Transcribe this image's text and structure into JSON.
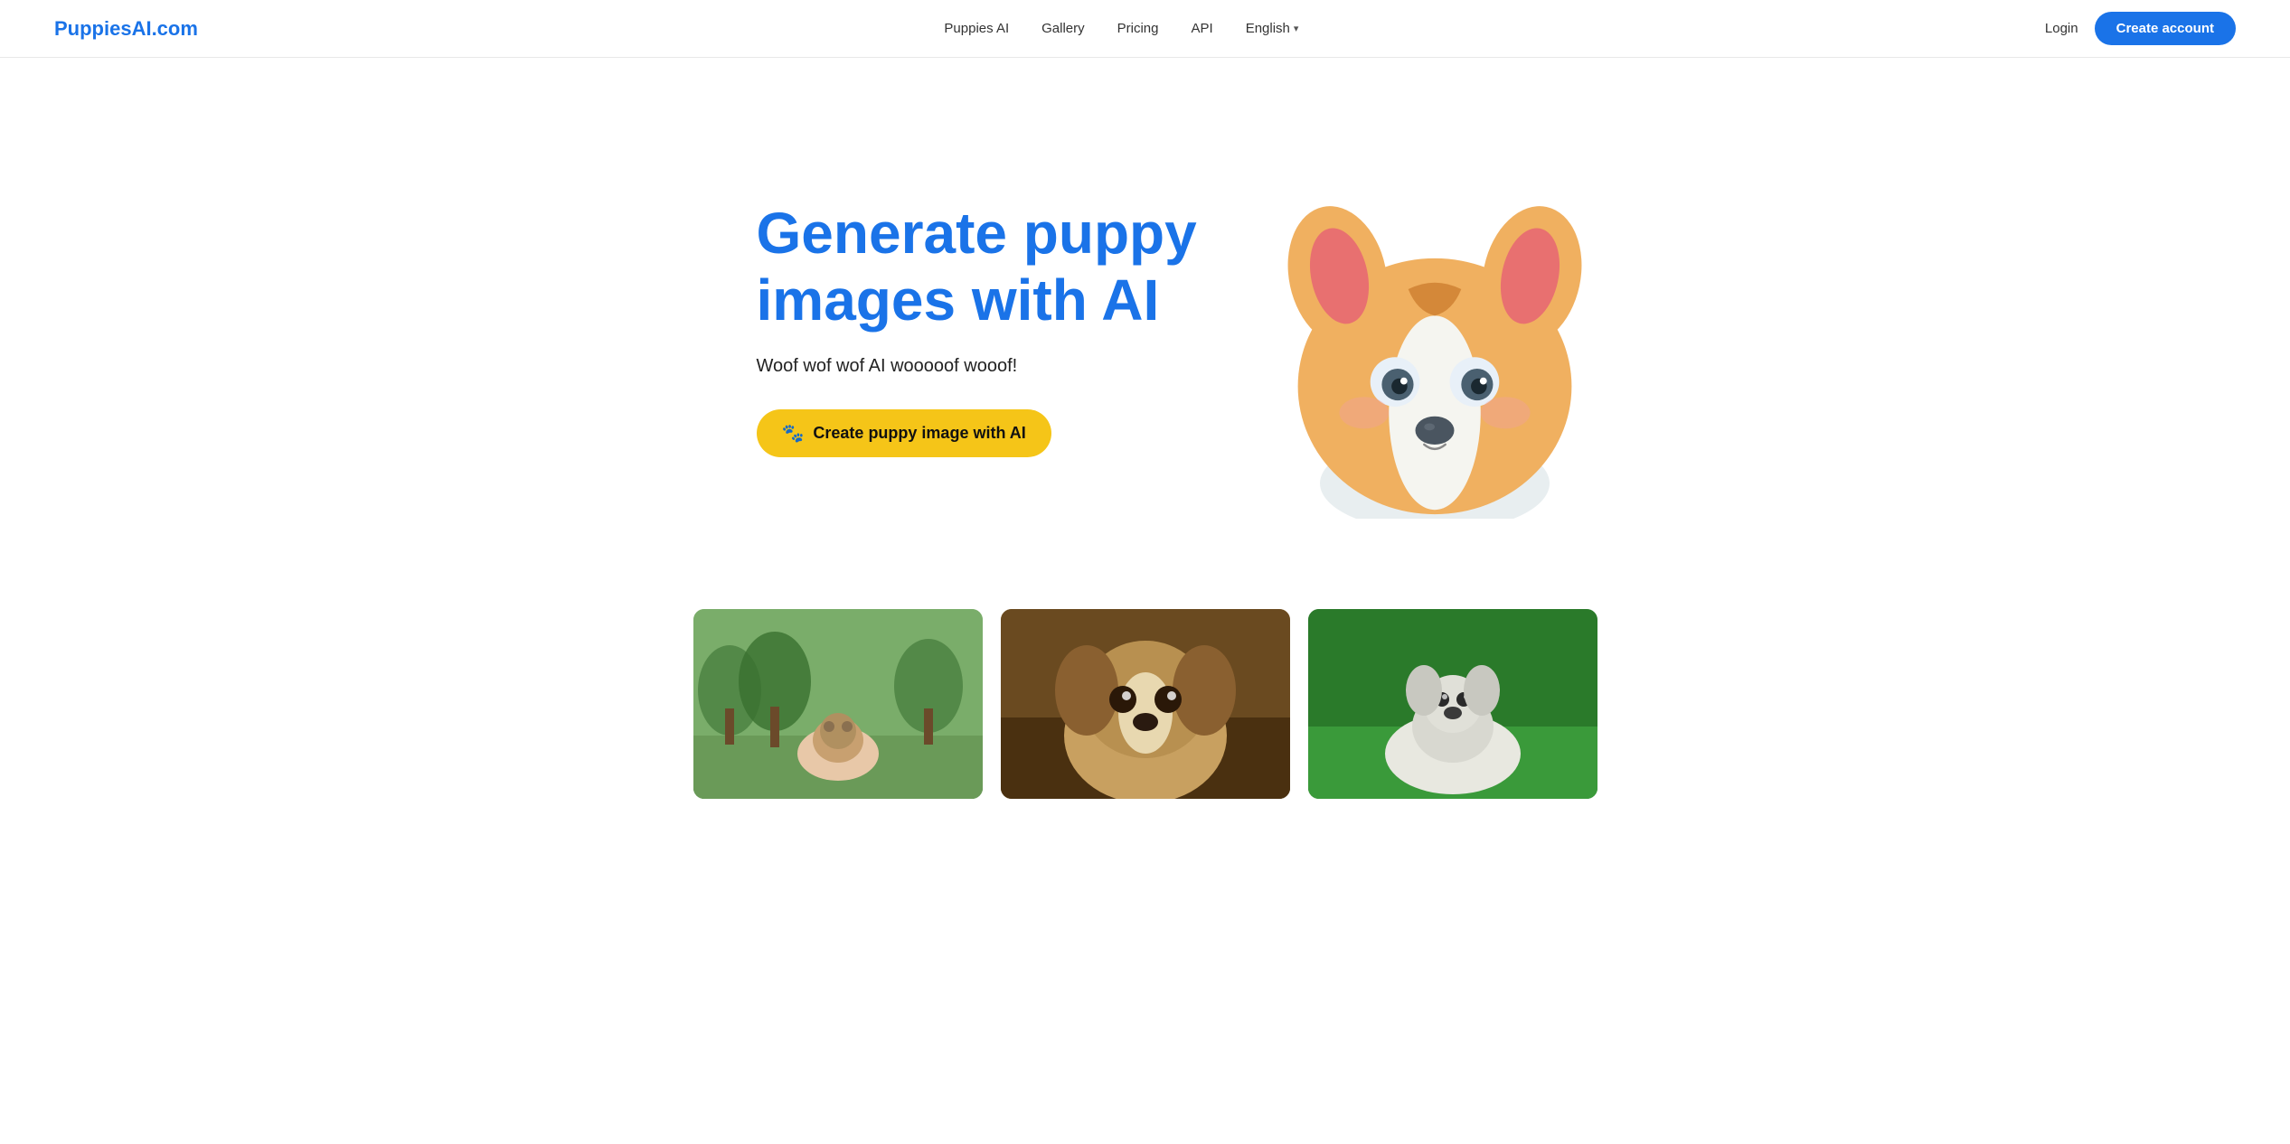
{
  "brand": {
    "logo": "PuppiesAI.com",
    "logo_color": "#1a73e8"
  },
  "nav": {
    "links": [
      {
        "id": "puppies-ai",
        "label": "Puppies AI"
      },
      {
        "id": "gallery",
        "label": "Gallery"
      },
      {
        "id": "pricing",
        "label": "Pricing"
      },
      {
        "id": "api",
        "label": "API"
      }
    ],
    "language": "English",
    "login_label": "Login",
    "cta_label": "Create account"
  },
  "hero": {
    "title": "Generate puppy images with AI",
    "subtitle": "Woof wof wof AI wooooof wooof!",
    "cta_label": "Create puppy image with AI",
    "paw_icon": "🐾"
  },
  "gallery": {
    "images": [
      {
        "id": "img1",
        "alt": "Puppy in park"
      },
      {
        "id": "img2",
        "alt": "Puppy portrait"
      },
      {
        "id": "img3",
        "alt": "Puppy on grass"
      }
    ]
  }
}
